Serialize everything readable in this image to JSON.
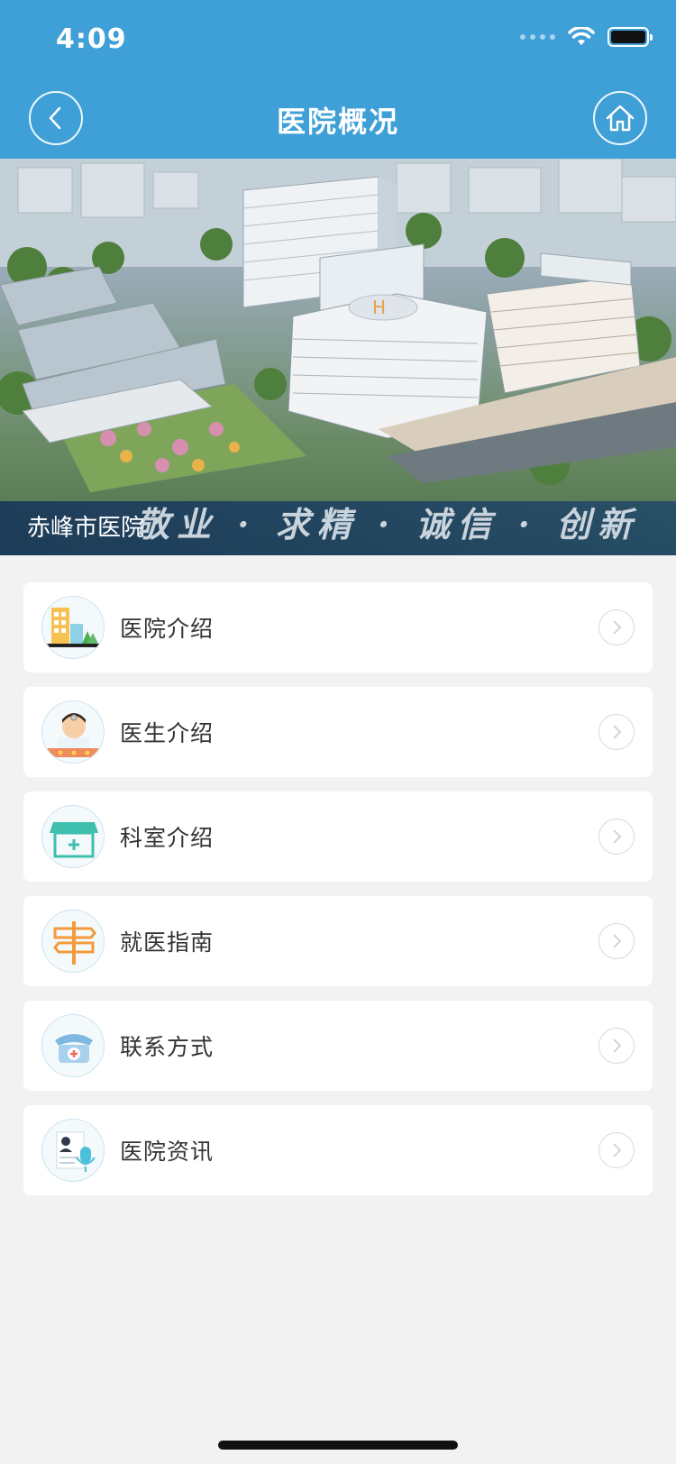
{
  "status_bar": {
    "time": "4:09"
  },
  "nav": {
    "title": "医院概况"
  },
  "banner": {
    "caption": "赤峰市医院",
    "motto": "敬业 · 求精 · 诚信 · 创新"
  },
  "menu": {
    "items": [
      {
        "label": "医院介绍",
        "icon": "hospital-building-icon"
      },
      {
        "label": "医生介绍",
        "icon": "doctor-icon"
      },
      {
        "label": "科室介绍",
        "icon": "department-icon"
      },
      {
        "label": "就医指南",
        "icon": "signpost-icon"
      },
      {
        "label": "联系方式",
        "icon": "telephone-icon"
      },
      {
        "label": "医院资讯",
        "icon": "news-icon"
      }
    ]
  },
  "colors": {
    "header": "#3f9fd7",
    "background": "#f2f2f2"
  }
}
